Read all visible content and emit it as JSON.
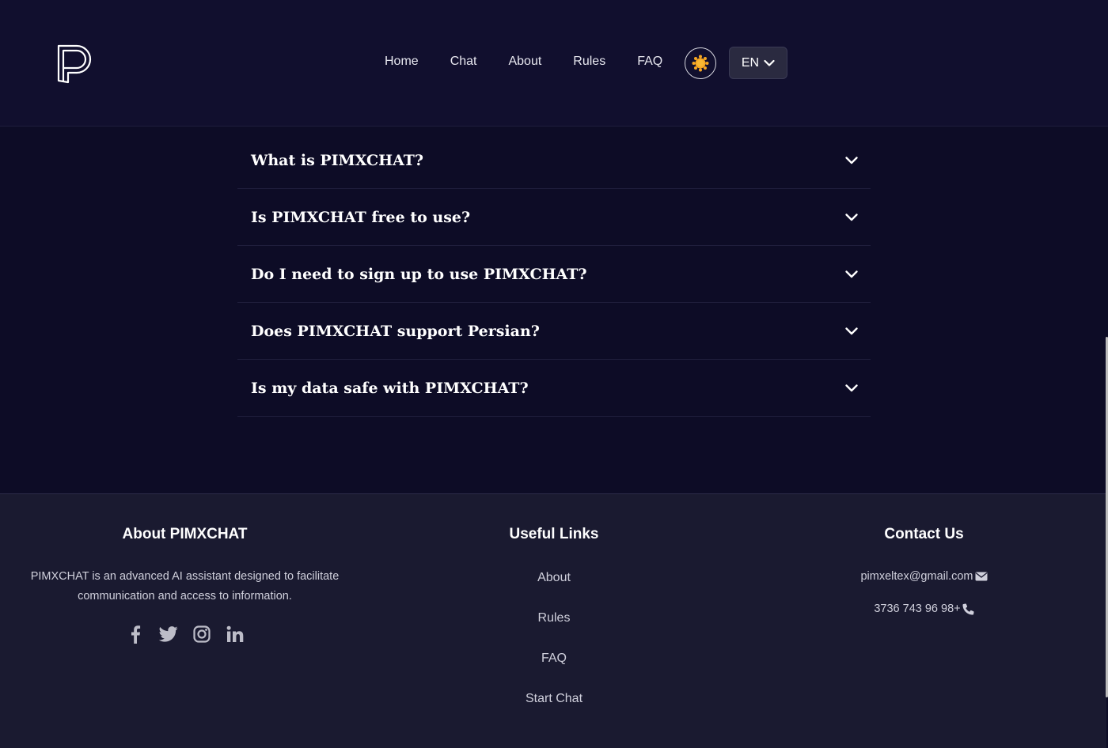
{
  "header": {
    "nav": [
      "Home",
      "Chat",
      "About",
      "Rules",
      "FAQ"
    ],
    "language": "EN"
  },
  "faq": {
    "items": [
      "What is PIMXCHAT?",
      "Is PIMXCHAT free to use?",
      "Do I need to sign up to use PIMXCHAT?",
      "Does PIMXCHAT support Persian?",
      "Is my data safe with PIMXCHAT?"
    ]
  },
  "footer": {
    "about": {
      "title": "About PIMXCHAT",
      "text_line1": "PIMXCHAT is an advanced AI assistant designed to facilitate",
      "text_line2": "communication and access to information.",
      "socials": [
        "facebook-icon",
        "twitter-icon",
        "instagram-icon",
        "linkedin-icon"
      ]
    },
    "links": {
      "title": "Useful Links",
      "items": [
        "About",
        "Rules",
        "FAQ",
        "Start Chat"
      ]
    },
    "contact": {
      "title": "Contact Us",
      "email": "pimxeltex@gmail.com",
      "phone": "3736 743 96 98+"
    }
  },
  "colors": {
    "background": "#0d0c26",
    "header": "#110f2e",
    "footer": "#1a1a30",
    "accent_sun": "#f5a623"
  }
}
